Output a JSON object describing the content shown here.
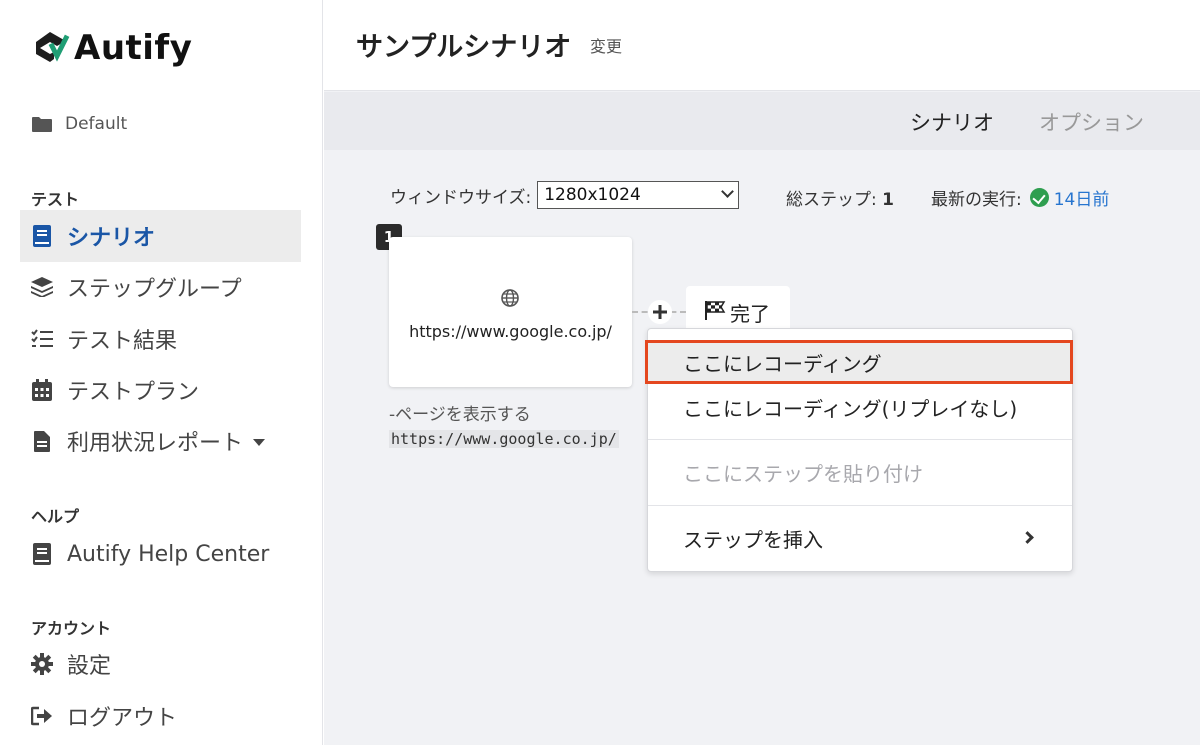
{
  "app": {
    "logo_text": "Autify",
    "brand_color": "#1f9e74"
  },
  "sidebar": {
    "project": "Default",
    "sections": {
      "test": "テスト",
      "help": "ヘルプ",
      "account": "アカウント"
    },
    "items": [
      {
        "label": "シナリオ",
        "icon": "book-icon",
        "active": true
      },
      {
        "label": "ステップグループ",
        "icon": "layers-icon"
      },
      {
        "label": "テスト結果",
        "icon": "checklist-icon"
      },
      {
        "label": "テストプラン",
        "icon": "calendar-icon"
      },
      {
        "label": "利用状況レポート",
        "icon": "document-icon",
        "has_dropdown": true
      },
      {
        "label": "Autify Help Center",
        "icon": "book-icon"
      },
      {
        "label": "設定",
        "icon": "gear-icon"
      },
      {
        "label": "ログアウト",
        "icon": "logout-icon"
      }
    ]
  },
  "header": {
    "title": "サンプルシナリオ",
    "change_link": "変更"
  },
  "tabs": [
    {
      "label": "シナリオ",
      "active": true
    },
    {
      "label": "オプション",
      "active": false
    }
  ],
  "scenario": {
    "window_size_label": "ウィンドウサイズ:",
    "window_size_value": "1280x1024",
    "total_steps_label": "総ステップ:",
    "total_steps_value": "1",
    "latest_run_label": "最新の実行:",
    "latest_run_value": "14日前",
    "status_color": "#2e9e4f",
    "link_color": "#2775cf"
  },
  "step": {
    "number": "1",
    "url": "https://www.google.co.jp/",
    "desc_prefix": "-ページを表示する",
    "desc_code": "https://www.google.co.jp/"
  },
  "finish_label": "完了",
  "context_menu": {
    "items": [
      {
        "label": "ここにレコーディング",
        "highlighted": true
      },
      {
        "label": "ここにレコーディング(リプレイなし)"
      },
      {
        "label": "ここにステップを貼り付け",
        "disabled": true
      },
      {
        "label": "ステップを挿入",
        "has_submenu": true
      }
    ],
    "highlight_border_color": "#e4471f"
  }
}
